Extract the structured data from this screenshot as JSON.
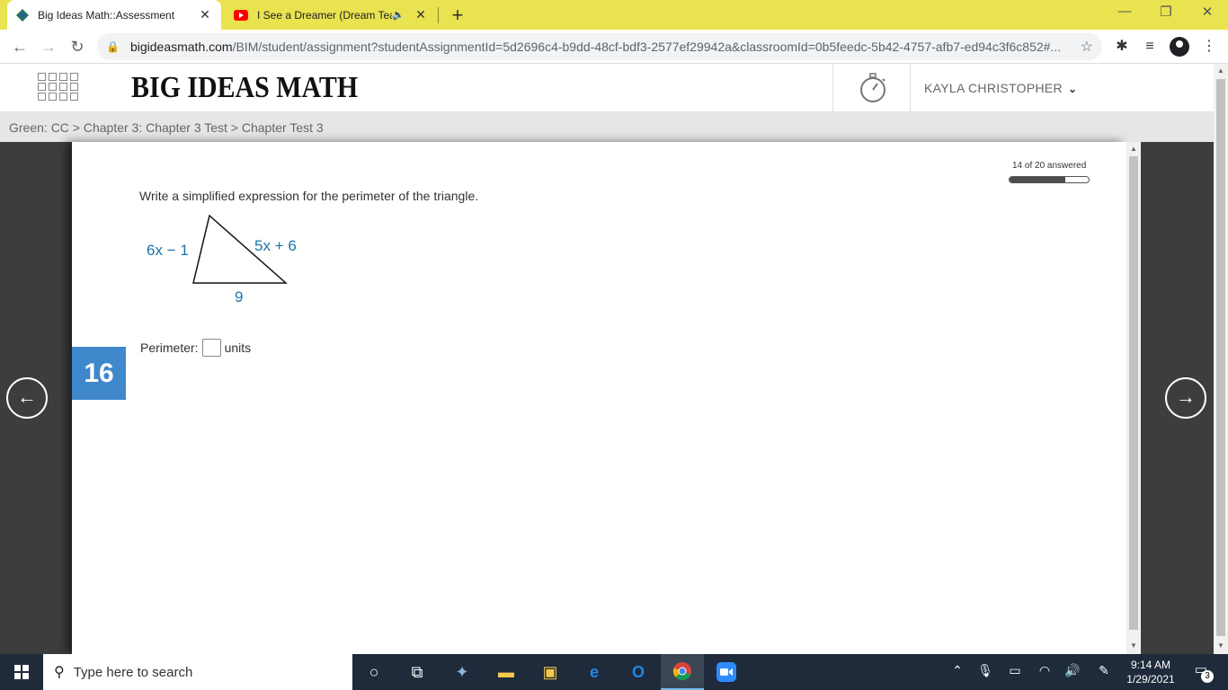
{
  "browser": {
    "tabs": [
      {
        "title": "Big Ideas Math::Assessment",
        "active": true
      },
      {
        "title": "I See a Dreamer (Dream Tea",
        "active": false,
        "audio": true
      }
    ],
    "url_host": "bigideasmath.com",
    "url_path": "/BIM/student/assignment?studentAssignmentId=5d2696c4-b9dd-48cf-bdf3-2577ef29942a&classroomId=0b5feedc-5b42-4757-afb7-ed94c3f6c852#..."
  },
  "app": {
    "logo": "BIG IDEAS MATH",
    "user_name": "KAYLA CHRISTOPHER",
    "breadcrumb": "Green: CC > Chapter 3: Chapter 3 Test > Chapter Test 3"
  },
  "progress": {
    "text": "14 of 20 answered",
    "answered": 14,
    "total": 20
  },
  "question": {
    "number": "16",
    "prompt": "Write a simplified expression for the perimeter of the triangle.",
    "figure": {
      "side_left": "6x − 1",
      "side_right": "5x + 6",
      "side_bottom": "9",
      "label_color": "#1b75a8"
    },
    "answer_label": "Perimeter:",
    "answer_value": "",
    "answer_unit": "units"
  },
  "taskbar": {
    "search_placeholder": "Type here to search",
    "time": "9:14 AM",
    "date": "1/29/2021",
    "notifications": "3"
  },
  "colors": {
    "tabstrip": "#e9e34f",
    "question_badge": "#3f88cc",
    "side_panel": "#3b3d3f",
    "taskbar": "#1f2a3a"
  }
}
